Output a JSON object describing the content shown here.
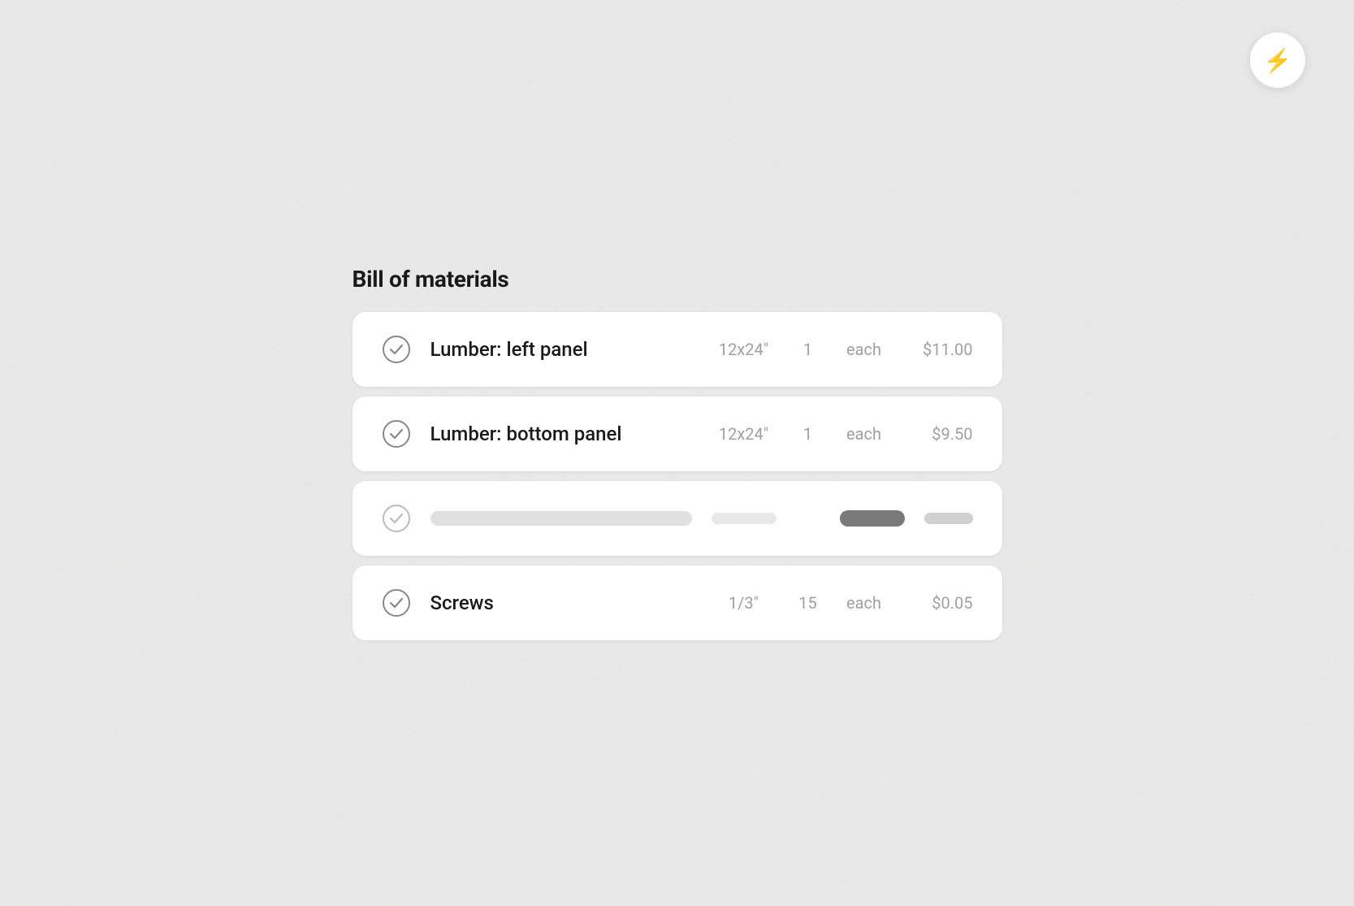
{
  "app": {
    "lightning_label": "⚡"
  },
  "page": {
    "title": "Bill of materials"
  },
  "items": [
    {
      "id": "item-1",
      "name": "Lumber: left panel",
      "dimension": "12x24\"",
      "quantity": "1",
      "unit": "each",
      "price": "$11.00",
      "is_skeleton": false
    },
    {
      "id": "item-2",
      "name": "Lumber: bottom panel",
      "dimension": "12x24\"",
      "quantity": "1",
      "unit": "each",
      "price": "$9.50",
      "is_skeleton": false
    },
    {
      "id": "item-3",
      "name": "",
      "dimension": "",
      "quantity": "",
      "unit": "",
      "price": "",
      "is_skeleton": true
    },
    {
      "id": "item-4",
      "name": "Screws",
      "dimension": "1/3\"",
      "quantity": "15",
      "unit": "each",
      "price": "$0.05",
      "is_skeleton": false
    }
  ]
}
